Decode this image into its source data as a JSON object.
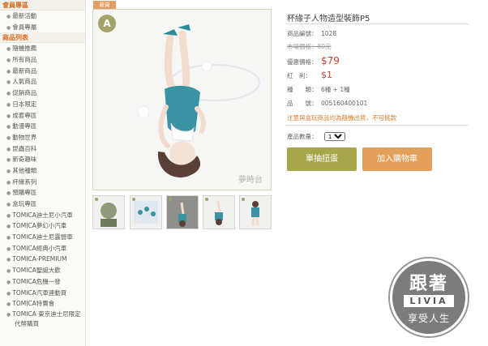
{
  "sidebar": {
    "sections": [
      {
        "heading": "會員專區",
        "items": [
          "最新活動",
          "會員專屬"
        ]
      },
      {
        "heading": "商品列表",
        "items": [
          "隨機推薦",
          "所有商品",
          "最新商品",
          "人氣商品",
          "促銷商品",
          "日本限定",
          "成套專區",
          "動漫專區",
          "動物世界",
          "昆蟲百科",
          "新奇趣味",
          "其他種類",
          "杯緣系列",
          "預購專區",
          "盒玩專區",
          "TOMICA迪士尼小汽車",
          "TOMICA夢幻小汽車",
          "TOMICA迪士尼露營車",
          "TOMICA經典小汽車",
          "TOMICA-PREMIUM",
          "TOMICA聖誕大歡",
          "TOMICA危機一發",
          "TOMICA汽車連動買",
          "TOMICA特賣會",
          "TOMICA 東京迪士尼限定",
          "代幣購買"
        ]
      }
    ]
  },
  "product": {
    "new_badge": "新貨",
    "grade": "A",
    "image_signature": "夢時台",
    "title": "杯緣子人物造型裝飾P5",
    "fields": {
      "id_label": "商品編號：",
      "id_value": "1028",
      "orig_label": "市場價格：",
      "orig_value": "80元",
      "price_label": "優惠價格：",
      "price_value": "$79",
      "bonus_label": "紅　利：",
      "bonus_value": "$1",
      "kinds_label": "種　　類：",
      "kinds_value": "6種 + 1種",
      "code_label": "品　　號：",
      "code_value": "005160400101"
    },
    "notice": "注意與盒玩商品均為隨機出貨，不可挑款",
    "qty_label": "產品數量：",
    "qty_value": "1",
    "btn_gacha": "單抽扭蛋",
    "btn_cart": "加入購物車"
  },
  "stamp": {
    "line1": "跟著",
    "line2": "LIVIA",
    "line3": "享受人生"
  },
  "colors": {
    "accent_orange": "#e3a05a",
    "accent_green": "#a6a64a",
    "price_red": "#c8452c"
  }
}
